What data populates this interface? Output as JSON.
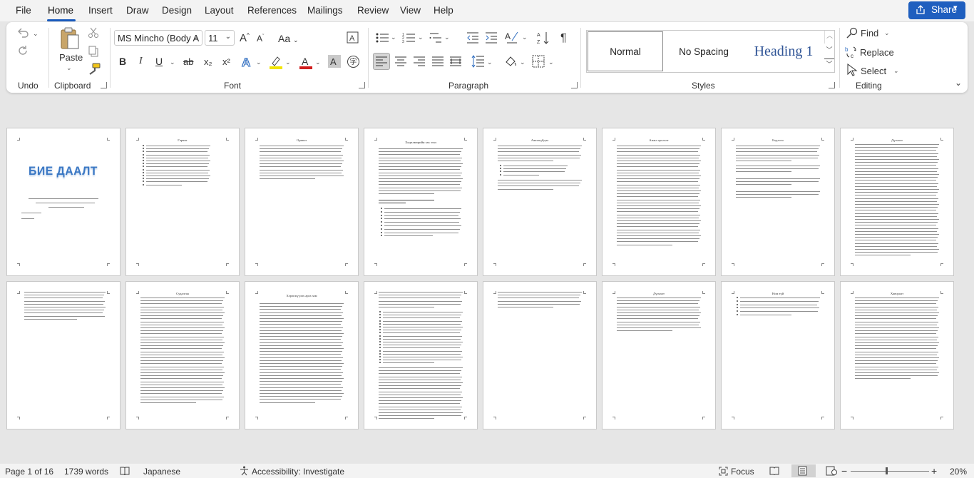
{
  "menu": {
    "file": "File",
    "home": "Home",
    "insert": "Insert",
    "draw": "Draw",
    "design": "Design",
    "layout": "Layout",
    "references": "References",
    "mailings": "Mailings",
    "review": "Review",
    "view": "View",
    "help": "Help",
    "share": "Share"
  },
  "ribbon": {
    "groups": {
      "undo": "Undo",
      "clipboard": "Clipboard",
      "font": "Font",
      "paragraph": "Paragraph",
      "styles": "Styles",
      "editing": "Editing"
    },
    "paste_label": "Paste",
    "font_name": "MS Mincho (Body A",
    "font_size": "11",
    "grow_font": "A",
    "case_font": "Aa",
    "bold": "B",
    "italic": "I",
    "underline": "U",
    "strike": "ab",
    "subscript": "x₂",
    "superscript": "x²",
    "styles": {
      "normal": "Normal",
      "no_spacing": "No Spacing",
      "heading1": "Heading 1"
    },
    "editing": {
      "find": "Find",
      "replace": "Replace",
      "select": "Select"
    }
  },
  "pages": {
    "cover_logo": "БИЕ ДААЛТ",
    "p2_title": "Гарчиг",
    "p3_title": "Оршил",
    "p4_title": "Хөдөлмөрийн зах зээл",
    "p5_title": "Ажилгүйдэл",
    "p6_title": "Ажил эрхлэлт",
    "p7_title": "Бодлого",
    "p8_title": "Дүгнэлт",
    "p10_title": "Судалгаа",
    "p11_title": "Хэрэгжүүлэх арга зам",
    "p14_title": "Дүгнэлт",
    "p15_title": "Ном зүй",
    "p16_title": "Хавсралт"
  },
  "status": {
    "page": "Page 1 of 16",
    "words": "1739 words",
    "language": "Japanese",
    "accessibility": "Accessibility: Investigate",
    "focus": "Focus",
    "zoom": "20%"
  },
  "colors": {
    "accent": "#185abd",
    "share_bg": "#1f5fbf",
    "heading1": "#2f5496",
    "logo": "#3b78c4"
  }
}
